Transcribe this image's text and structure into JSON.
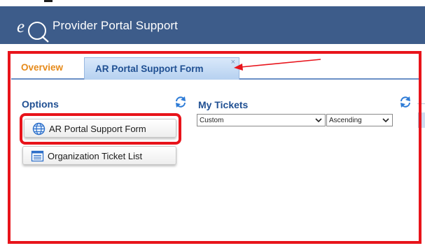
{
  "header": {
    "title": "Provider Portal Support",
    "logo_icon": "eq-logo"
  },
  "tabs": [
    {
      "label": "Overview",
      "active": false
    },
    {
      "label": "AR Portal Support Form",
      "active": true,
      "close_glyph": "×"
    }
  ],
  "options": {
    "title": "Options",
    "items": [
      {
        "label": "AR Portal Support Form",
        "icon": "globe-icon"
      },
      {
        "label": "Organization Ticket List",
        "icon": "list-window-icon"
      }
    ]
  },
  "my_tickets": {
    "title": "My Tickets",
    "sort_field": "Custom",
    "sort_order": "Ascending"
  },
  "colors": {
    "header_bg": "#3d5c8a",
    "annotation_red": "#e8141b",
    "title_blue": "#1f4f92",
    "overview_orange": "#e68a1a"
  }
}
